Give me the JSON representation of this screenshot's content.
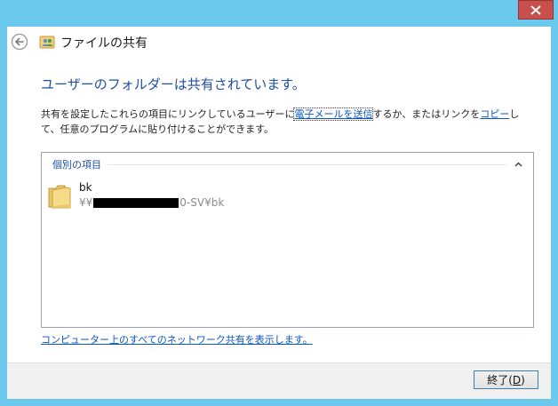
{
  "window": {
    "title": "ファイルの共有",
    "accent": "#6bc9ee",
    "close_color": "#c7504c"
  },
  "header": {
    "back_icon": "back-arrow-icon",
    "app_icon": "file-sharing-icon"
  },
  "content": {
    "heading": "ユーザーのフォルダーは共有されています。",
    "description": {
      "part1": "共有を設定したこれらの項目にリンクしているユーザーに",
      "email_link": "電子メールを送信",
      "part2": "するか、またはリンクを",
      "copy_link": "コピー",
      "part3": "して、任意のプログラムに貼り付けることができます。"
    },
    "group": {
      "label": "個別の項目",
      "collapse_icon": "chevron-up-icon"
    },
    "items": [
      {
        "name": "bk",
        "path_prefix": "¥¥",
        "path_suffix": "0-SV¥bk",
        "icon": "folder-icon"
      }
    ],
    "network_link": "コンピューター上のすべてのネットワーク共有を表示します。"
  },
  "footer": {
    "finish_label": "終了(",
    "finish_accel": "D",
    "finish_close": ")"
  }
}
